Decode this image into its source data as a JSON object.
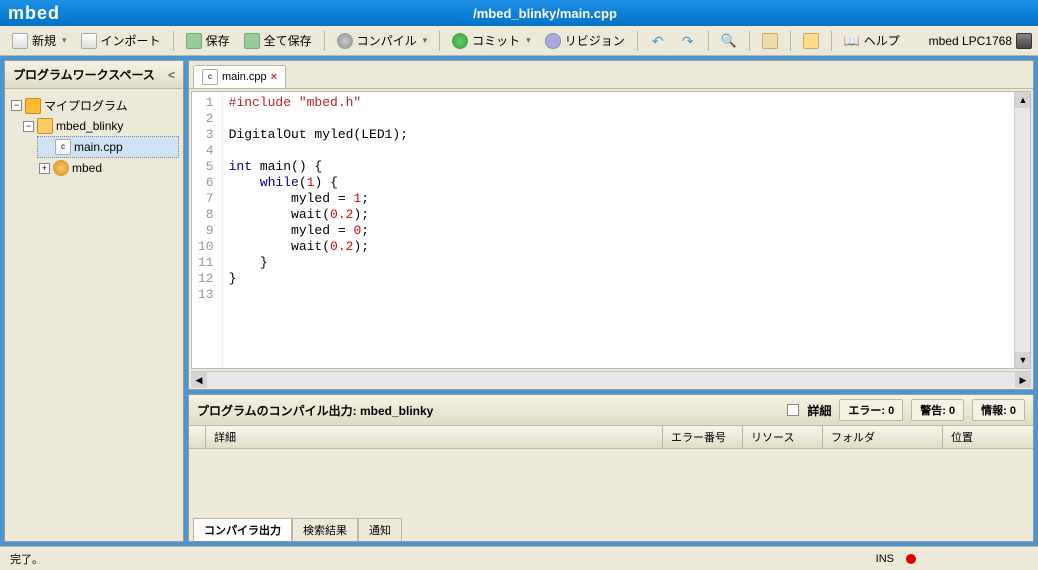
{
  "titlebar": {
    "brand": "mbed",
    "path": "/mbed_blinky/main.cpp"
  },
  "toolbar": {
    "new": "新規",
    "import": "インポート",
    "save": "保存",
    "save_all": "全て保存",
    "compile": "コンパイル",
    "commit": "コミット",
    "revision": "リビジョン",
    "help": "ヘルプ",
    "device": "mbed LPC1768"
  },
  "sidebar": {
    "title": "プログラムワークスペース",
    "root": "マイプログラム",
    "project": "mbed_blinky",
    "file": "main.cpp",
    "lib": "mbed"
  },
  "editor": {
    "tab": "main.cpp",
    "lines": [
      {
        "n": 1,
        "tokens": [
          [
            "inc",
            "#include "
          ],
          [
            "str",
            "\"mbed.h\""
          ]
        ]
      },
      {
        "n": 2,
        "tokens": []
      },
      {
        "n": 3,
        "tokens": [
          [
            "plain",
            "DigitalOut myled(LED1);"
          ]
        ]
      },
      {
        "n": 4,
        "tokens": []
      },
      {
        "n": 5,
        "tokens": [
          [
            "type",
            "int"
          ],
          [
            "plain",
            " main() {"
          ]
        ]
      },
      {
        "n": 6,
        "tokens": [
          [
            "plain",
            "    "
          ],
          [
            "kw",
            "while"
          ],
          [
            "plain",
            "("
          ],
          [
            "num",
            "1"
          ],
          [
            "plain",
            ") {"
          ]
        ]
      },
      {
        "n": 7,
        "tokens": [
          [
            "plain",
            "        myled = "
          ],
          [
            "num",
            "1"
          ],
          [
            "plain",
            ";"
          ]
        ]
      },
      {
        "n": 8,
        "tokens": [
          [
            "plain",
            "        wait("
          ],
          [
            "num",
            "0.2"
          ],
          [
            "plain",
            ");"
          ]
        ]
      },
      {
        "n": 9,
        "tokens": [
          [
            "plain",
            "        myled = "
          ],
          [
            "num",
            "0"
          ],
          [
            "plain",
            ";"
          ]
        ]
      },
      {
        "n": 10,
        "tokens": [
          [
            "plain",
            "        wait("
          ],
          [
            "num",
            "0.2"
          ],
          [
            "plain",
            ");"
          ]
        ]
      },
      {
        "n": 11,
        "tokens": [
          [
            "plain",
            "    }"
          ]
        ]
      },
      {
        "n": 12,
        "tokens": [
          [
            "plain",
            "}"
          ]
        ]
      },
      {
        "n": 13,
        "tokens": []
      }
    ]
  },
  "output": {
    "title_prefix": "プログラムのコンパイル出力: ",
    "title_project": "mbed_blinky",
    "detail_label": "詳細",
    "errors_label": "エラー:",
    "errors_count": "0",
    "warns_label": "警告:",
    "warns_count": "0",
    "infos_label": "情報:",
    "infos_count": "0",
    "cols": {
      "detail": "詳細",
      "errno": "エラー番号",
      "resource": "リソース",
      "folder": "フォルダ",
      "position": "位置"
    },
    "tabs": {
      "compiler": "コンパイラ出力",
      "search": "検索結果",
      "notify": "通知"
    }
  },
  "status": {
    "done": "完了。",
    "ins": "INS"
  }
}
